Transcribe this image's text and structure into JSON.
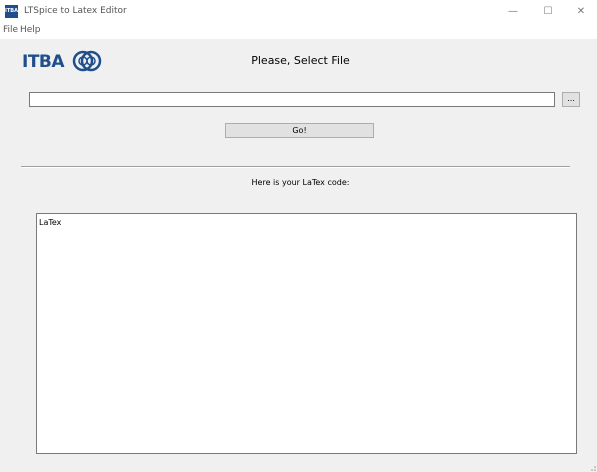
{
  "window": {
    "title": "LTSpice to Latex Editor",
    "icon_label": "ITBA",
    "controls": {
      "minimize": "—",
      "maximize": "☐",
      "close": "✕"
    }
  },
  "menu": {
    "items": [
      "File",
      "Help"
    ]
  },
  "logo": {
    "text": "ITBA"
  },
  "main": {
    "heading": "Please, Select File",
    "file_path": "",
    "browse_label": "...",
    "go_label": "Go!",
    "result_label": "Here is your LaTex code:",
    "output_text": "LaTex"
  },
  "colors": {
    "brand": "#1f4e8c",
    "background": "#f0f0f0",
    "button": "#e1e1e1"
  }
}
